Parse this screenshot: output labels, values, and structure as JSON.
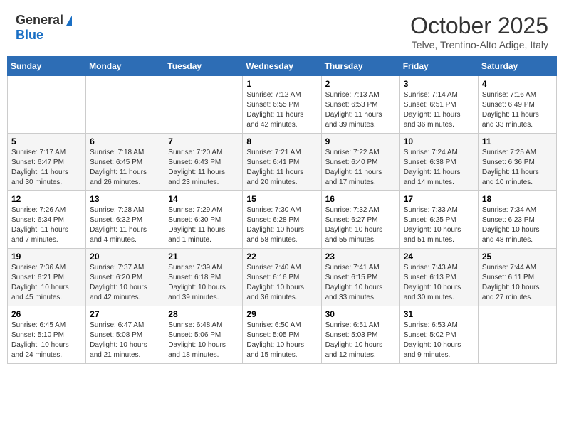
{
  "header": {
    "logo_general": "General",
    "logo_blue": "Blue",
    "month_title": "October 2025",
    "location": "Telve, Trentino-Alto Adige, Italy"
  },
  "days_of_week": [
    "Sunday",
    "Monday",
    "Tuesday",
    "Wednesday",
    "Thursday",
    "Friday",
    "Saturday"
  ],
  "weeks": [
    [
      {
        "day": "",
        "info": ""
      },
      {
        "day": "",
        "info": ""
      },
      {
        "day": "",
        "info": ""
      },
      {
        "day": "1",
        "info": "Sunrise: 7:12 AM\nSunset: 6:55 PM\nDaylight: 11 hours and 42 minutes."
      },
      {
        "day": "2",
        "info": "Sunrise: 7:13 AM\nSunset: 6:53 PM\nDaylight: 11 hours and 39 minutes."
      },
      {
        "day": "3",
        "info": "Sunrise: 7:14 AM\nSunset: 6:51 PM\nDaylight: 11 hours and 36 minutes."
      },
      {
        "day": "4",
        "info": "Sunrise: 7:16 AM\nSunset: 6:49 PM\nDaylight: 11 hours and 33 minutes."
      }
    ],
    [
      {
        "day": "5",
        "info": "Sunrise: 7:17 AM\nSunset: 6:47 PM\nDaylight: 11 hours and 30 minutes."
      },
      {
        "day": "6",
        "info": "Sunrise: 7:18 AM\nSunset: 6:45 PM\nDaylight: 11 hours and 26 minutes."
      },
      {
        "day": "7",
        "info": "Sunrise: 7:20 AM\nSunset: 6:43 PM\nDaylight: 11 hours and 23 minutes."
      },
      {
        "day": "8",
        "info": "Sunrise: 7:21 AM\nSunset: 6:41 PM\nDaylight: 11 hours and 20 minutes."
      },
      {
        "day": "9",
        "info": "Sunrise: 7:22 AM\nSunset: 6:40 PM\nDaylight: 11 hours and 17 minutes."
      },
      {
        "day": "10",
        "info": "Sunrise: 7:24 AM\nSunset: 6:38 PM\nDaylight: 11 hours and 14 minutes."
      },
      {
        "day": "11",
        "info": "Sunrise: 7:25 AM\nSunset: 6:36 PM\nDaylight: 11 hours and 10 minutes."
      }
    ],
    [
      {
        "day": "12",
        "info": "Sunrise: 7:26 AM\nSunset: 6:34 PM\nDaylight: 11 hours and 7 minutes."
      },
      {
        "day": "13",
        "info": "Sunrise: 7:28 AM\nSunset: 6:32 PM\nDaylight: 11 hours and 4 minutes."
      },
      {
        "day": "14",
        "info": "Sunrise: 7:29 AM\nSunset: 6:30 PM\nDaylight: 11 hours and 1 minute."
      },
      {
        "day": "15",
        "info": "Sunrise: 7:30 AM\nSunset: 6:28 PM\nDaylight: 10 hours and 58 minutes."
      },
      {
        "day": "16",
        "info": "Sunrise: 7:32 AM\nSunset: 6:27 PM\nDaylight: 10 hours and 55 minutes."
      },
      {
        "day": "17",
        "info": "Sunrise: 7:33 AM\nSunset: 6:25 PM\nDaylight: 10 hours and 51 minutes."
      },
      {
        "day": "18",
        "info": "Sunrise: 7:34 AM\nSunset: 6:23 PM\nDaylight: 10 hours and 48 minutes."
      }
    ],
    [
      {
        "day": "19",
        "info": "Sunrise: 7:36 AM\nSunset: 6:21 PM\nDaylight: 10 hours and 45 minutes."
      },
      {
        "day": "20",
        "info": "Sunrise: 7:37 AM\nSunset: 6:20 PM\nDaylight: 10 hours and 42 minutes."
      },
      {
        "day": "21",
        "info": "Sunrise: 7:39 AM\nSunset: 6:18 PM\nDaylight: 10 hours and 39 minutes."
      },
      {
        "day": "22",
        "info": "Sunrise: 7:40 AM\nSunset: 6:16 PM\nDaylight: 10 hours and 36 minutes."
      },
      {
        "day": "23",
        "info": "Sunrise: 7:41 AM\nSunset: 6:15 PM\nDaylight: 10 hours and 33 minutes."
      },
      {
        "day": "24",
        "info": "Sunrise: 7:43 AM\nSunset: 6:13 PM\nDaylight: 10 hours and 30 minutes."
      },
      {
        "day": "25",
        "info": "Sunrise: 7:44 AM\nSunset: 6:11 PM\nDaylight: 10 hours and 27 minutes."
      }
    ],
    [
      {
        "day": "26",
        "info": "Sunrise: 6:45 AM\nSunset: 5:10 PM\nDaylight: 10 hours and 24 minutes."
      },
      {
        "day": "27",
        "info": "Sunrise: 6:47 AM\nSunset: 5:08 PM\nDaylight: 10 hours and 21 minutes."
      },
      {
        "day": "28",
        "info": "Sunrise: 6:48 AM\nSunset: 5:06 PM\nDaylight: 10 hours and 18 minutes."
      },
      {
        "day": "29",
        "info": "Sunrise: 6:50 AM\nSunset: 5:05 PM\nDaylight: 10 hours and 15 minutes."
      },
      {
        "day": "30",
        "info": "Sunrise: 6:51 AM\nSunset: 5:03 PM\nDaylight: 10 hours and 12 minutes."
      },
      {
        "day": "31",
        "info": "Sunrise: 6:53 AM\nSunset: 5:02 PM\nDaylight: 10 hours and 9 minutes."
      },
      {
        "day": "",
        "info": ""
      }
    ]
  ]
}
